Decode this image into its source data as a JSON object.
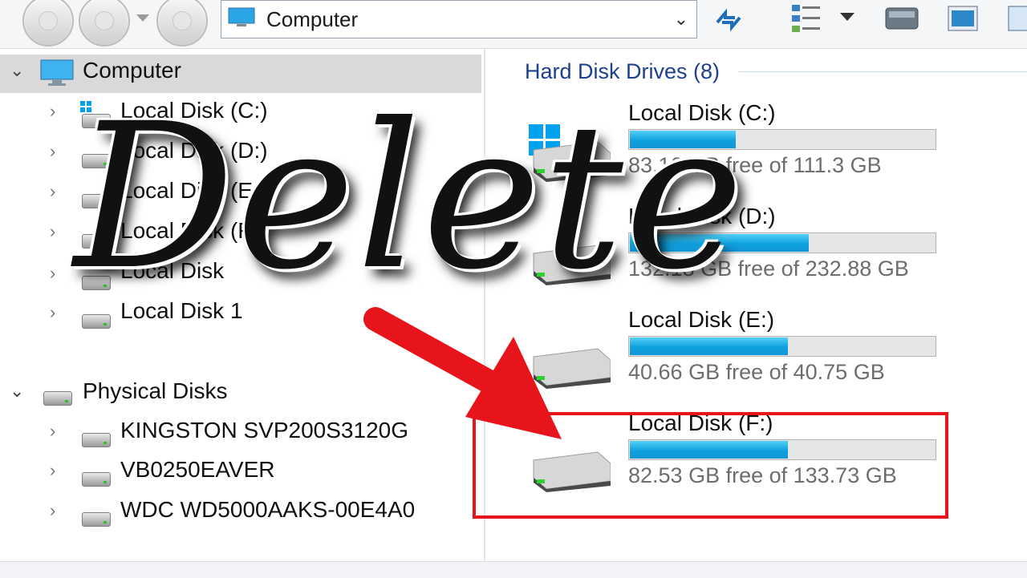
{
  "address_bar": {
    "location": "Computer"
  },
  "toolbar": {
    "icons": [
      "back-icon",
      "forward-icon",
      "history-dropdown-icon",
      "up-icon",
      "refresh-icon",
      "view-options-icon",
      "drive-icon",
      "preview-pane-icon"
    ]
  },
  "nav_tree": {
    "computer_label": "Computer",
    "volumes": [
      {
        "label": "Local Disk (C:)",
        "icon": "windows-drive-icon"
      },
      {
        "label": "Local Disk (D:)",
        "icon": "drive-icon"
      },
      {
        "label": "Local Disk (E:)",
        "icon": "drive-icon"
      },
      {
        "label": "Local Disk (F:)",
        "icon": "drive-icon"
      },
      {
        "label": "Local Disk",
        "icon": "drive-icon"
      },
      {
        "label": "Local Disk 1",
        "icon": "drive-icon"
      }
    ],
    "physical_label": "Physical Disks",
    "physical": [
      {
        "label": "KINGSTON SVP200S3120G"
      },
      {
        "label": "VB0250EAVER"
      },
      {
        "label": "WDC WD5000AAKS-00E4A0"
      }
    ]
  },
  "content": {
    "group_title": "Hard Disk Drives (8)",
    "drives": [
      {
        "name": "Local Disk (C:)",
        "free_text": "83.16 GB free of 111.3 GB",
        "used_fraction": 0.35,
        "icon": "windows-drive-icon"
      },
      {
        "name": "Local Disk (D:)",
        "free_text": "132.18 GB free of 232.88 GB",
        "used_fraction": 0.59,
        "icon": "drive-icon"
      },
      {
        "name": "Local Disk (E:)",
        "free_text": "40.66 GB free of 40.75 GB",
        "used_fraction": 0.52,
        "icon": "drive-icon"
      },
      {
        "name": "Local Disk (F:)",
        "free_text": "82.53 GB free of 133.73 GB",
        "used_fraction": 0.52,
        "icon": "drive-icon"
      }
    ]
  },
  "overlay": {
    "title": "Delete",
    "arrow_color": "#e8141b",
    "highlight_color": "#e8141b"
  },
  "colors": {
    "accent_blue": "#1e3f8f",
    "bar_fill": "#0ea1df",
    "selection": "#d9d9d9"
  }
}
